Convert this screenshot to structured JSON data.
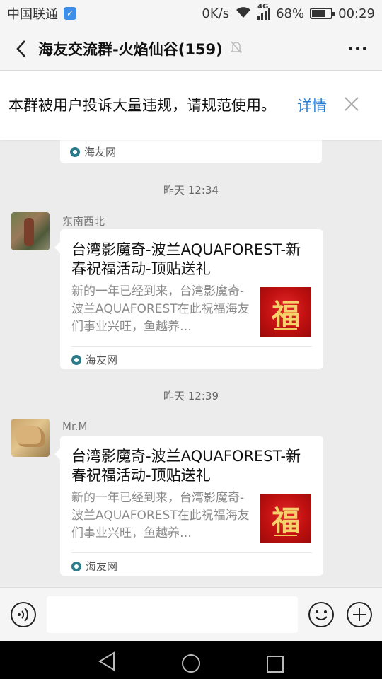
{
  "status_bar": {
    "carrier": "中国联通",
    "network_speed": "0K/s",
    "network_type": "4G",
    "battery": "68%",
    "battery_level": 0.68,
    "time": "00:29"
  },
  "header": {
    "title": "海友交流群-火焰仙谷(159)"
  },
  "warning": {
    "text": "本群被用户投诉大量违规，请规范使用。",
    "detail_label": "详情"
  },
  "messages": [
    {
      "partial": true,
      "source": "海友网"
    },
    {
      "timestamp": "昨天 12:34",
      "sender": "东南西北",
      "card": {
        "title": "台湾影魔奇-波兰AQUAFOREST-新春祝福活动-顶贴送礼",
        "description": "新的一年已经到来，台湾影魔奇-波兰AQUAFOREST在此祝福海友们事业兴旺，鱼越养…",
        "thumb_char": "福",
        "source": "海友网"
      }
    },
    {
      "timestamp": "昨天 12:39",
      "sender": "Mr.M",
      "card": {
        "title": "台湾影魔奇-波兰AQUAFOREST-新春祝福活动-顶贴送礼",
        "description": "新的一年已经到来，台湾影魔奇-波兰AQUAFOREST在此祝福海友们事业兴旺，鱼越养…",
        "thumb_char": "福",
        "source": "海友网"
      }
    }
  ],
  "input": {
    "placeholder": ""
  },
  "colors": {
    "accent_link": "#2a7fd4",
    "background": "#ececec",
    "card_thumb_red": "#c01010"
  }
}
